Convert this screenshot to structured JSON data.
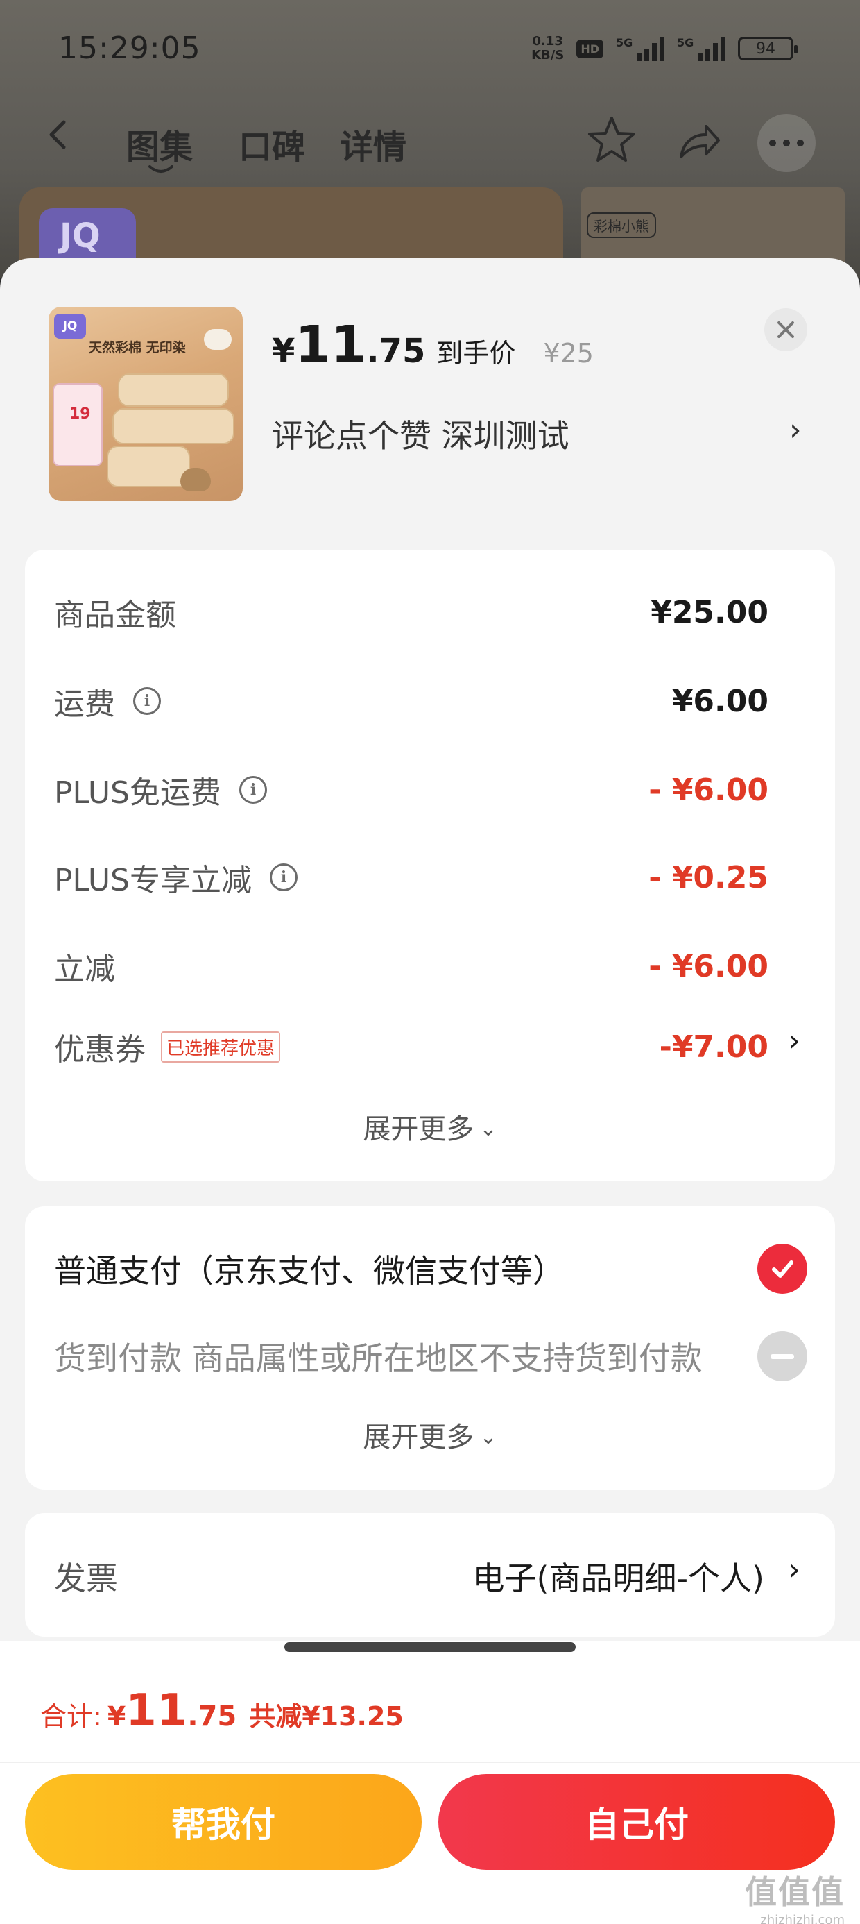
{
  "status_bar": {
    "time": "15:29:05",
    "speed_value": "0.13",
    "speed_unit": "KB/S",
    "hd_label": "HD",
    "net1": "5G",
    "net2": "5G",
    "battery": "94"
  },
  "top_nav": {
    "tabs": [
      "图集",
      "口碑",
      "详情"
    ]
  },
  "background": {
    "logo": "JQ",
    "tag": "彩棉小熊"
  },
  "product": {
    "thumb_logo": "JQ",
    "thumb_title": "天然彩棉 无印染",
    "thumb_promo": "19",
    "price_symbol": "¥",
    "price_integer": "11",
    "price_decimal": ".75",
    "price_label": "到手价",
    "original_price": "¥25",
    "spec": "评论点个赞  深圳测试"
  },
  "fees": {
    "rows": [
      {
        "label": "商品金额",
        "value": "¥25.00"
      },
      {
        "label": "运费",
        "value": "¥6.00"
      },
      {
        "label": "PLUS免运费",
        "value": "- ¥6.00"
      },
      {
        "label": "PLUS专享立减",
        "value": "- ¥0.25"
      },
      {
        "label": "立减",
        "value": "- ¥6.00"
      },
      {
        "label": "优惠券",
        "tag": "已选推荐优惠",
        "value": "-¥7.00"
      }
    ],
    "expand_label": "展开更多"
  },
  "payment": {
    "normal": "普通支付（京东支付、微信支付等）",
    "cod": "货到付款 商品属性或所在地区不支持货到付款",
    "expand_label": "展开更多"
  },
  "invoice": {
    "label": "发票",
    "value": "电子(商品明细-个人)"
  },
  "footer": {
    "total_label": "合计:",
    "total_symbol": "¥",
    "total_integer": "11",
    "total_decimal": ".75",
    "saved": "共减¥13.25",
    "help_pay": "帮我付",
    "self_pay": "自己付"
  },
  "watermark": {
    "glyphs": "值值值",
    "url": "zhizhizhi.com"
  },
  "colors": {
    "accent_red": "#e03a26",
    "button_yellow": "#fdc021",
    "button_red": "#f2384c",
    "check_red": "#ec2c3c"
  }
}
